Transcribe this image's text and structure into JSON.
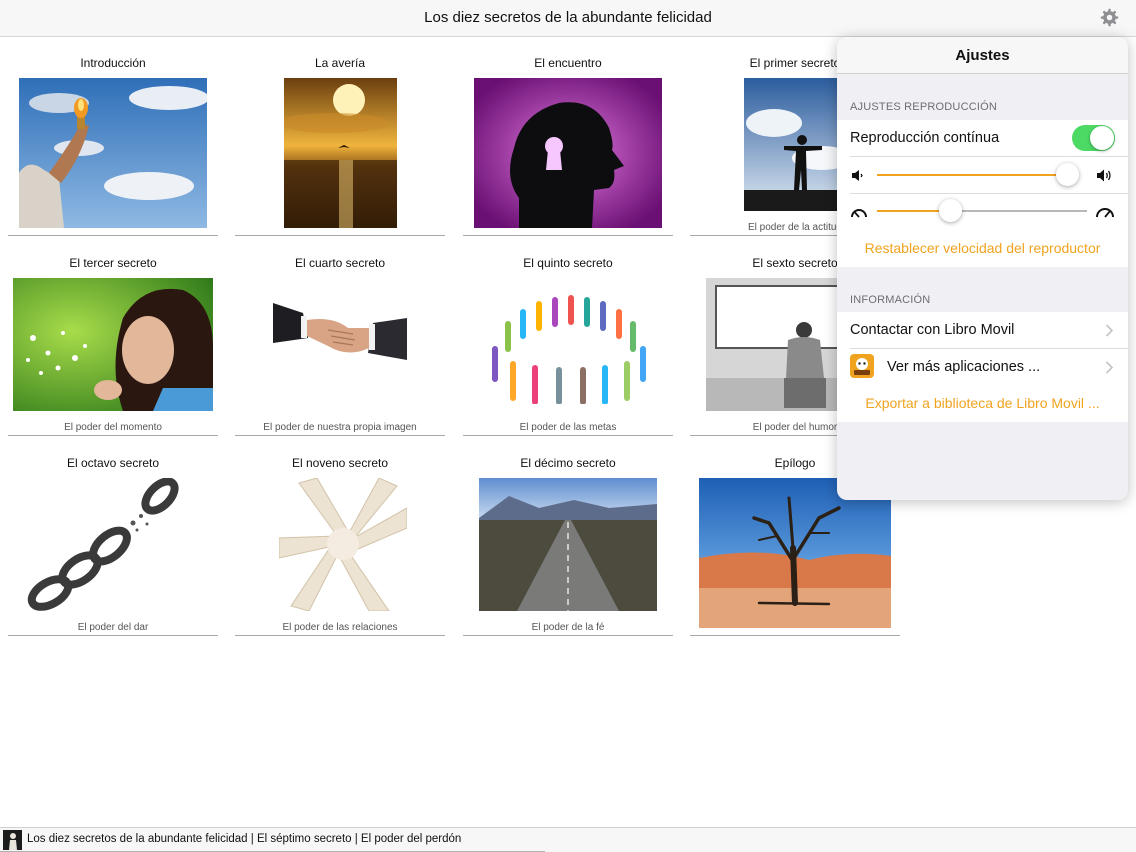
{
  "app": {
    "title": "Los diez secretos de la abundante felicidad",
    "settings_icon": "gear-icon"
  },
  "chapters": [
    {
      "title": "Introducción",
      "subtitle": ""
    },
    {
      "title": "La avería",
      "subtitle": ""
    },
    {
      "title": "El encuentro",
      "subtitle": ""
    },
    {
      "title": "El primer secreto",
      "subtitle": "El poder de la actitud"
    },
    {
      "title": "El tercer secreto",
      "subtitle": "El poder del momento"
    },
    {
      "title": "El cuarto secreto",
      "subtitle": "El poder de nuestra propia imagen"
    },
    {
      "title": "El quinto secreto",
      "subtitle": "El poder de las metas"
    },
    {
      "title": "El sexto secreto",
      "subtitle": "El poder del humor"
    },
    {
      "title": "El octavo secreto",
      "subtitle": "El poder del dar"
    },
    {
      "title": "El noveno secreto",
      "subtitle": "El poder de las relaciones"
    },
    {
      "title": "El décimo secreto",
      "subtitle": "El poder de la fé"
    },
    {
      "title": "Epílogo",
      "subtitle": ""
    }
  ],
  "settings": {
    "title": "Ajustes",
    "playback": {
      "header": "AJUSTES REPRODUCCIÓN",
      "continuous_label": "Reproducción contínua",
      "continuous_on": true,
      "volume_level": 0.96,
      "speed_level": 0.35,
      "reset_speed_label": "Restablecer velocidad del reproductor"
    },
    "info": {
      "header": "INFORMACIÓN",
      "contact_label": "Contactar con Libro Movil",
      "more_apps_label": "Ver más aplicaciones ...",
      "export_label": "Exportar a biblioteca de Libro Movil ..."
    },
    "colors": {
      "accent": "#f0a31f",
      "toggle_on": "#4cd964"
    }
  },
  "now_playing": {
    "text": "Los diez secretos de la abundante felicidad | El séptimo secreto | El poder del perdón",
    "progress": 0.48
  }
}
